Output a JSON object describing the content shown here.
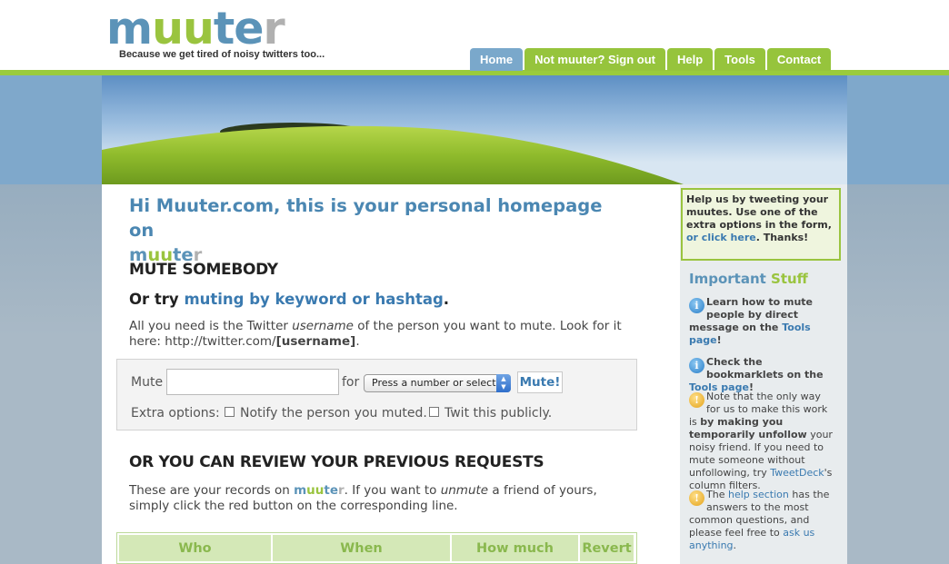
{
  "header": {
    "logo": {
      "m": "m",
      "uu": "uu",
      "te": "te",
      "r": "r"
    },
    "tagline": "Because we get tired of noisy twitters too..."
  },
  "nav": [
    {
      "label": "Home",
      "active": true
    },
    {
      "label": "Not muuter? Sign out",
      "active": false
    },
    {
      "label": "Help",
      "active": false
    },
    {
      "label": "Tools",
      "active": false
    },
    {
      "label": "Contact",
      "active": false
    }
  ],
  "main": {
    "greeting": "Hi Muuter.com, this is your personal homepage on",
    "mute_heading": "MUTE SOMEBODY",
    "or_try": "Or try",
    "keyword_link": "muting by keyword or hashtag",
    "instr_1": "All you need is the Twitter",
    "instr_em": "username",
    "instr_2": "of the person you want to mute. Look for it here: http://twitter.com/",
    "instr_bold": "[username]",
    "instr_end": ".",
    "form": {
      "mute_label": "Mute",
      "mute_value": "",
      "for_label": "for",
      "select_value": "Press a number or select",
      "submit_label": "Mute!",
      "extra_label": "Extra options:",
      "opt_notify": "Notify the person you muted.",
      "opt_twit": "Twit this publicly."
    },
    "review_heading": "OR YOU CAN REVIEW YOUR PREVIOUS REQUESTS",
    "records_1": "These are your records on",
    "records_2": ". If you want to",
    "records_em": "unmute",
    "records_3": "a friend of yours, simply click the red button on the corresponding line.",
    "table_headers": [
      "Who",
      "When",
      "How much",
      "Revert"
    ]
  },
  "sidebar": {
    "help_text": "Help us by tweeting your muutes. Use one of the extra options in the form,",
    "help_link": "or click here",
    "help_end": ". Thanks!",
    "important_a": "Important",
    "important_b": "Stuff",
    "tip1_bold": "Learn how to mute people by direct message on the",
    "tip1_link": "Tools page",
    "tip1_end": "!",
    "tip2_bold": "Check the bookmarklets on the",
    "tip2_link": "Tools page",
    "tip2_end": "!",
    "tip3_1": "Note that the only way for us to make this work is",
    "tip3_bold": "by making you temporarily unfollow",
    "tip3_2": "your noisy friend. If you need to mute someone without unfollowing, try",
    "tip3_link": "TweetDeck",
    "tip3_3": "'s column filters.",
    "tip4_1": "The",
    "tip4_link": "help section",
    "tip4_2": "has the answers to the most common questions, and please feel free to",
    "tip4_link2": "ask us anything",
    "tip4_3": "."
  },
  "colors": {
    "brand_blue": "#5b93b8",
    "brand_green": "#9ac43f",
    "nav_green": "#96c43c",
    "nav_active": "#7aa8cb"
  }
}
